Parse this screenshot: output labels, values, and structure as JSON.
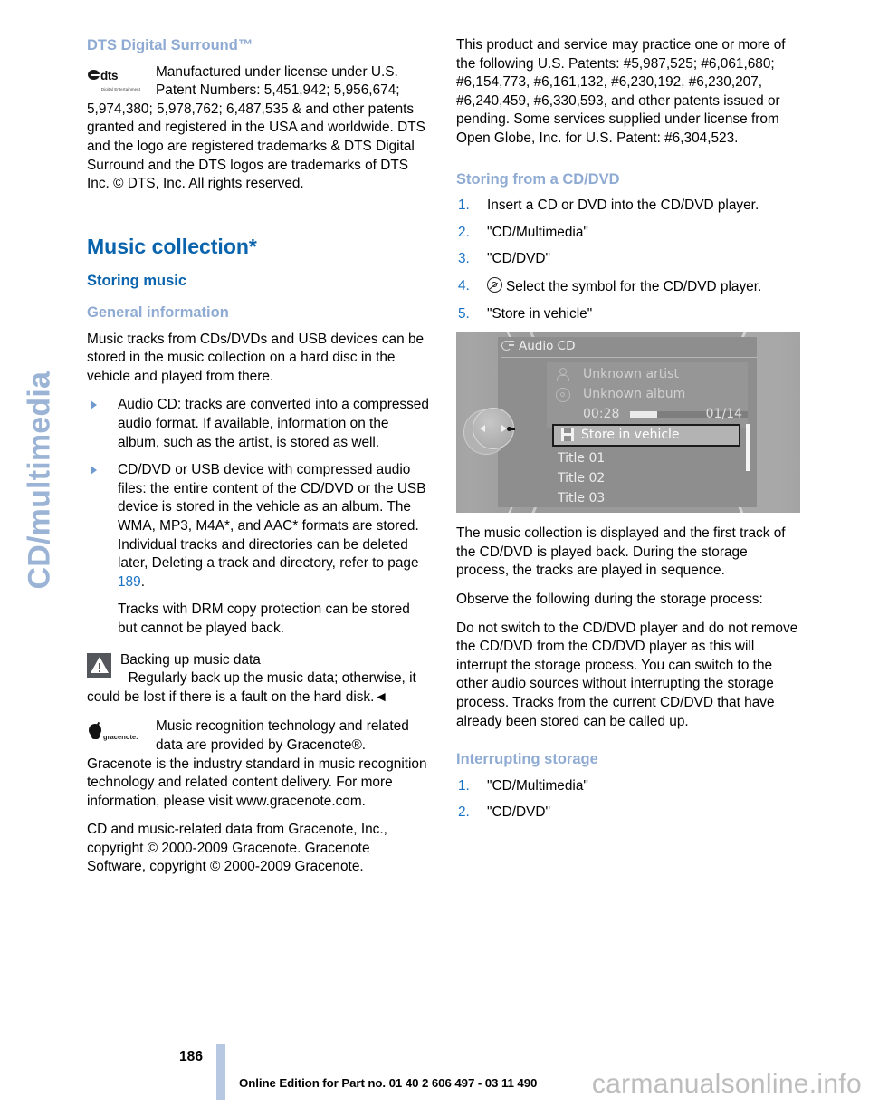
{
  "side_tab": {
    "label": "CD/multimedia"
  },
  "left_column": {
    "dts_heading": "DTS Digital Surround™",
    "dts_logo": {
      "word": "dts",
      "tagline": "Digital Entertainment"
    },
    "dts_text": "Manufactured under license under U.S. Patent Numbers: 5,451,942; 5,956,674; 5,974,380; 5,978,762; 6,487,535 & and other patents granted and registered in the USA and worldwide. DTS and the logo are registered trademarks & DTS Digital Surround and the DTS logos are trademarks of DTS Inc. © DTS, Inc. All rights reserved.",
    "music_collection_heading": "Music collection*",
    "storing_music_heading": "Storing music",
    "general_info_heading": "General information",
    "general_info_text": "Music tracks from CDs/DVDs and USB devices can be stored in the music collection on a hard disc in the vehicle and played from there.",
    "bullets": [
      "Audio CD: tracks are converted into a compressed audio format. If available, information on the album, such as the artist, is stored as well.",
      "CD/DVD or USB device with compressed audio files: the entire content of the CD/DVD or the USB device is stored in the vehicle as an album. The WMA, MP3, M4A*, and AAC* formats are stored. Individual tracks and directories can be deleted later, Deleting a track and directory, refer to page "
    ],
    "bullet2_pageref": "189",
    "bullet2_suffix": ".",
    "drm_text": "Tracks with DRM copy protection can be stored but cannot be played back.",
    "note": {
      "title": "Backing up music data",
      "body": "Regularly back up the music data; otherwise, it could be lost if there is a fault on the hard disk.◄"
    },
    "gracenote_logo_word": "gracenote.",
    "gracenote_text": "Music recognition technology and related data are provided by Gracenote®. Gracenote is the industry standard in music recognition technology and related content delivery. For more information, please visit www.gracenote.com.",
    "gracenote_copyright": "CD and music-related data from Gracenote, Inc., copyright © 2000-2009 Gracenote. Gracenote Software, copyright © 2000-2009 Gracenote."
  },
  "right_column": {
    "patents_text": "This product and service may practice one or more of the following U.S. Patents: #5,987,525; #6,061,680; #6,154,773, #6,161,132, #6,230,192, #6,230,207, #6,240,459, #6,330,593, and other patents issued or pending. Some services supplied under license from Open Globe, Inc. for U.S. Patent: #6,304,523.",
    "storing_cd_heading": "Storing from a CD/DVD",
    "storing_steps": [
      {
        "num": "1.",
        "text": "Insert a CD or DVD into the CD/DVD player.",
        "icon": ""
      },
      {
        "num": "2.",
        "text": "\"CD/Multimedia\"",
        "icon": ""
      },
      {
        "num": "3.",
        "text": "\"CD/DVD\"",
        "icon": ""
      },
      {
        "num": "4.",
        "text": "Select the symbol for the CD/DVD player.",
        "icon": "cd-disc-icon"
      },
      {
        "num": "5.",
        "text": "\"Store in vehicle\"",
        "icon": ""
      }
    ],
    "after_image_text_1": "The music collection is displayed and the first track of the CD/DVD is played back. During the storage process, the tracks are played in sequence.",
    "after_image_text_2": "Observe the following during the storage process:",
    "after_image_text_3": "Do not switch to the CD/DVD player and do not remove the CD/DVD from the CD/DVD player as this will interrupt the storage process. You can switch to the other audio sources without interrupting the storage process. Tracks from the current CD/DVD that have already been stored can be called up.",
    "interrupting_heading": "Interrupting storage",
    "interrupting_steps": [
      {
        "num": "1.",
        "text": "\"CD/Multimedia\""
      },
      {
        "num": "2.",
        "text": "\"CD/DVD\""
      }
    ]
  },
  "idrive_screenshot": {
    "header": "Audio CD",
    "artist": "Unknown artist",
    "album": "Unknown album",
    "elapsed_time": "00:28",
    "track_counter": "01/14",
    "selected_item": "Store in vehicle",
    "tracks": [
      "Title  01",
      "Title  02",
      "Title  03"
    ],
    "progress_percent": 23
  },
  "footer": {
    "page_number": "186",
    "edition_text": "Online Edition for Part no. 01 40 2 606 497 - 03 11 490",
    "watermark": "carmanualsonline.info"
  },
  "colors": {
    "heading_dark_blue": "#0a64ad",
    "heading_light_blue": "#8fabd3",
    "side_tab_blue": "#9bb4d6",
    "page_ref_blue": "#1a72c4",
    "footer_bar": "#b6c8e2",
    "warning_icon_bg": "#53565a"
  }
}
